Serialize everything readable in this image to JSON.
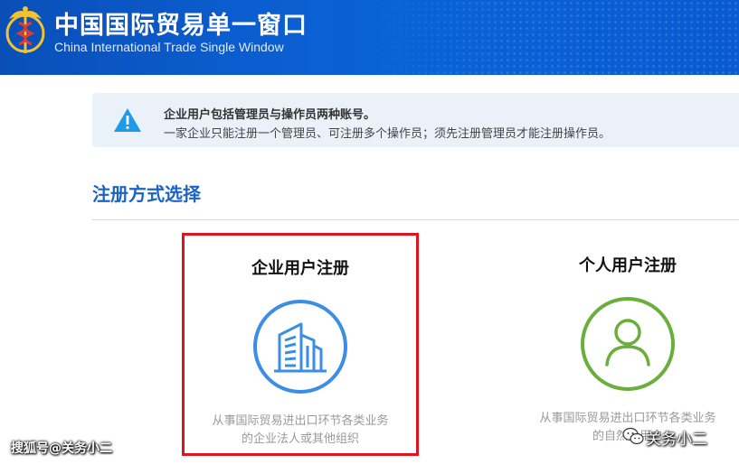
{
  "header": {
    "title": "中国国际贸易单一窗口",
    "subtitle": "China International Trade Single  Window",
    "logo_icon": "customs-emblem-icon",
    "bg_color": "#0b5ed0"
  },
  "notice": {
    "icon": "warning-icon",
    "line1": "企业用户包括管理员与操作员两种账号。",
    "line2": "一家企业只能注册一个管理员、可注册多个操作员；须先注册管理员才能注册操作员。",
    "icon_color": "#1e9be8"
  },
  "section": {
    "title": "注册方式选择",
    "title_color": "#1a63c7"
  },
  "cards": [
    {
      "title": "企业用户注册",
      "icon": "building-icon",
      "desc_line1": "从事国际贸易进出口环节各类业务",
      "desc_line2": "的企业法人或其他组织",
      "ring_color": "#3a8ee6",
      "highlight_color": "#e0141e"
    },
    {
      "title": "个人用户注册",
      "icon": "person-icon",
      "desc_line1": "从事国际贸易进出口环节各类业务",
      "desc_line2": "的自然人用户",
      "ring_color": "#6aae3b"
    }
  ],
  "watermarks": {
    "left": "搜狐号@关务小二",
    "right": "关务小二",
    "right_icon": "wechat-icon"
  }
}
